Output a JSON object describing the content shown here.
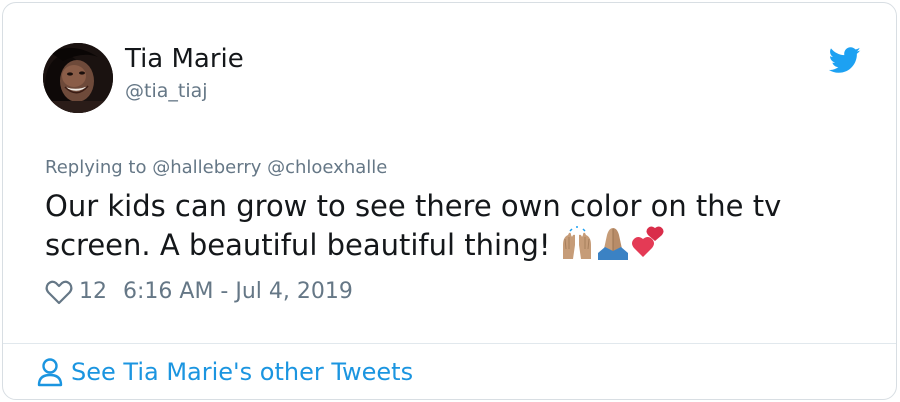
{
  "tweet": {
    "author": {
      "name": "Tia Marie",
      "handle": "@tia_tiaj",
      "avatar_icon": "profile-photo"
    },
    "brand_icon": "twitter-bird-icon",
    "replying_prefix": "Replying to",
    "reply_mentions": [
      "@halleberry",
      "@chloexhalle"
    ],
    "text": "Our kids can grow to see there own color on the tv screen. A beautiful beautiful thing!",
    "emojis": [
      "raising-hands-emoji",
      "folded-hands-emoji",
      "two-hearts-emoji"
    ],
    "likes": "12",
    "timestamp": "6:16 AM - Jul 4, 2019"
  },
  "footer": {
    "label": "See Tia Marie's other Tweets",
    "icon": "person-icon"
  },
  "colors": {
    "brand_blue": "#1da1f2",
    "link_blue": "#1b95e0",
    "text_primary": "#14171a",
    "text_secondary": "#657786",
    "border": "#d8dee3"
  }
}
